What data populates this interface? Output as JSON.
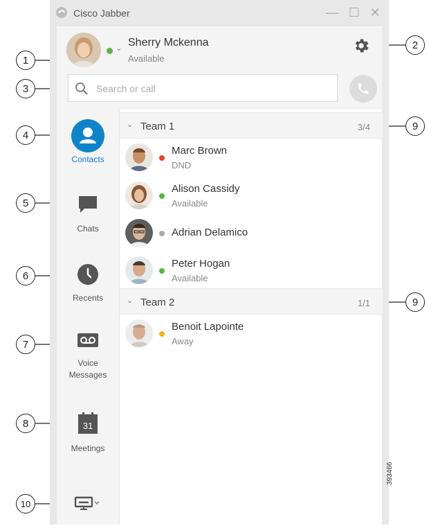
{
  "window": {
    "title": "Cisco Jabber",
    "minimize_glyph": "—",
    "maximize_glyph": "☐",
    "close_glyph": "✕"
  },
  "user": {
    "name": "Sherry Mckenna",
    "status": "Available",
    "presence_color": "#5ab642"
  },
  "search": {
    "placeholder": "Search or call"
  },
  "nav": {
    "contacts": "Contacts",
    "chats": "Chats",
    "recents": "Recents",
    "voice_messages_line1": "Voice",
    "voice_messages_line2": "Messages",
    "meetings": "Meetings",
    "meetings_day": "31"
  },
  "groups": [
    {
      "name": "Team 1",
      "count": "3/4",
      "contacts": [
        {
          "name": "Marc Brown",
          "status": "DND",
          "presence_color": "#e8412f"
        },
        {
          "name": "Alison Cassidy",
          "status": "Available",
          "presence_color": "#5ab642"
        },
        {
          "name": "Adrian Delamico",
          "status": "",
          "presence_color": "#aaaaaa"
        },
        {
          "name": "Peter Hogan",
          "status": "Available",
          "presence_color": "#5ab642"
        }
      ]
    },
    {
      "name": "Team 2",
      "count": "1/1",
      "contacts": [
        {
          "name": "Benoit Lapointe",
          "status": "Away",
          "presence_color": "#f6b221"
        }
      ]
    }
  ],
  "callouts": [
    "1",
    "2",
    "3",
    "4",
    "5",
    "6",
    "7",
    "8",
    "9",
    "9",
    "10"
  ],
  "figure_id": "393466",
  "colors": {
    "accent": "#0f83c8",
    "icon_dark": "#555555"
  }
}
